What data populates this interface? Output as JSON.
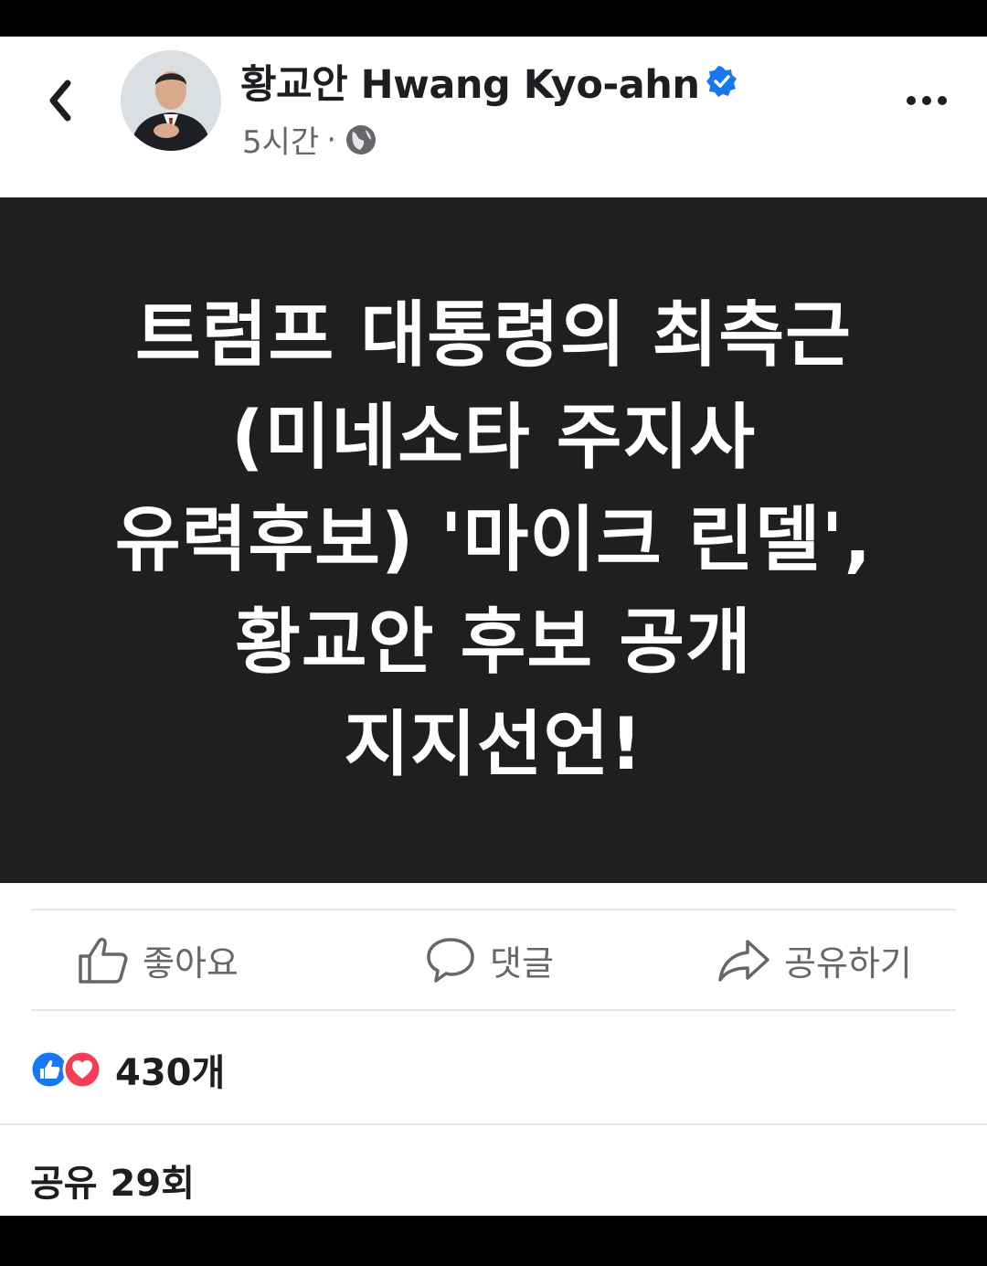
{
  "header": {
    "author_name": "황교안 Hwang Kyo-ahn",
    "timestamp": "5시간",
    "separator": "·",
    "audience_icon": "globe-icon",
    "back_icon": "chevron-left-icon",
    "more_icon": "ellipsis-icon",
    "verified_icon": "verified-badge-icon"
  },
  "post_image": {
    "text": "트럼프 대통령의 최측근 (미네소타 주지사 유력후보) '마이크 린델', 황교안 후보 공개 지지선언!"
  },
  "actions": {
    "like_label": "좋아요",
    "comment_label": "댓글",
    "share_label": "공유하기"
  },
  "stats": {
    "reaction_count": "430개",
    "shares": "공유 29회"
  },
  "colors": {
    "verified": "#1877f2",
    "like_reaction": "#1877f2",
    "love_reaction": "#f33e58",
    "image_background": "#1f1f1f"
  }
}
